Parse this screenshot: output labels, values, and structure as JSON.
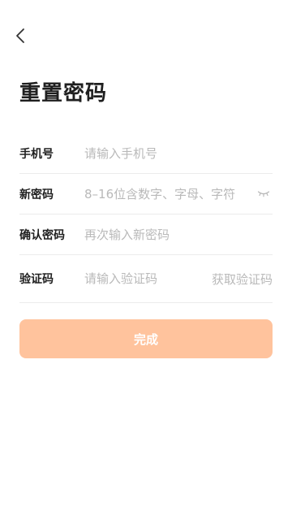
{
  "page_title": "重置密码",
  "form": {
    "phone": {
      "label": "手机号",
      "placeholder": "请输入手机号",
      "value": ""
    },
    "new_password": {
      "label": "新密码",
      "placeholder": "8–16位含数字、字母、字符",
      "value": ""
    },
    "confirm_password": {
      "label": "确认密码",
      "placeholder": "再次输入新密码",
      "value": ""
    },
    "code": {
      "label": "验证码",
      "placeholder": "请输入验证码",
      "value": "",
      "get_code_label": "获取验证码"
    }
  },
  "submit_label": "完成",
  "icons": {
    "back": "chevron-left-icon",
    "password_toggle": "eye-closed-icon"
  },
  "colors": {
    "accent": "#ffc39d",
    "text": "#1f1f1f",
    "placeholder": "#b9b9b9",
    "divider": "#ececec"
  }
}
